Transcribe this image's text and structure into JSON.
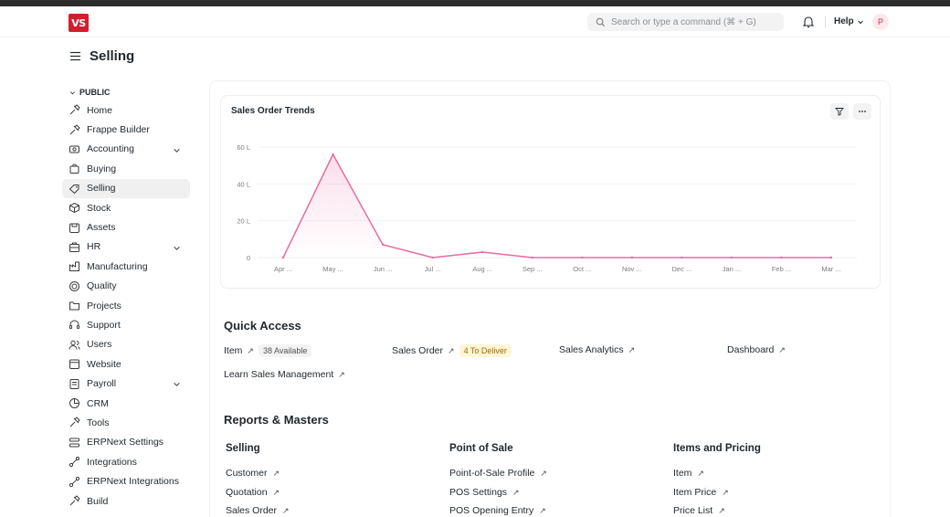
{
  "app": {
    "logo_text": "VS",
    "search_placeholder": "Search or type a command (⌘ + G)",
    "help_label": "Help",
    "avatar_initial": "P",
    "page_title": "Selling"
  },
  "sidebar": {
    "section_label": "PUBLIC",
    "items": [
      {
        "label": "Home",
        "icon": "tools-icon"
      },
      {
        "label": "Frappe Builder",
        "icon": "tools-icon"
      },
      {
        "label": "Accounting",
        "icon": "accounting-icon"
      },
      {
        "label": "Buying",
        "icon": "buying-icon"
      },
      {
        "label": "Selling",
        "icon": "selling-icon"
      },
      {
        "label": "Stock",
        "icon": "stock-icon"
      },
      {
        "label": "Assets",
        "icon": "assets-icon"
      },
      {
        "label": "HR",
        "icon": "hr-icon"
      },
      {
        "label": "Manufacturing",
        "icon": "manufacturing-icon"
      },
      {
        "label": "Quality",
        "icon": "quality-icon"
      },
      {
        "label": "Projects",
        "icon": "projects-icon"
      },
      {
        "label": "Support",
        "icon": "support-icon"
      },
      {
        "label": "Users",
        "icon": "users-icon"
      },
      {
        "label": "Website",
        "icon": "website-icon"
      },
      {
        "label": "Payroll",
        "icon": "payroll-icon"
      },
      {
        "label": "CRM",
        "icon": "crm-icon"
      },
      {
        "label": "Tools",
        "icon": "tools-icon"
      },
      {
        "label": "ERPNext Settings",
        "icon": "settings-icon"
      },
      {
        "label": "Integrations",
        "icon": "integrations-icon"
      },
      {
        "label": "ERPNext Integrations",
        "icon": "integrations-icon"
      },
      {
        "label": "Build",
        "icon": "tools-icon"
      }
    ]
  },
  "chart": {
    "title": "Sales Order Trends",
    "filter_icon": "filter-icon",
    "menu_icon": "more-icon",
    "color": "#e86ba3"
  },
  "chart_data": {
    "type": "line",
    "categories": [
      "Apr ...",
      "May ...",
      "Jun ...",
      "Jul ...",
      "Aug ...",
      "Sep ...",
      "Oct ...",
      "Nov ...",
      "Dec ...",
      "Jan ...",
      "Feb ...",
      "Mar ..."
    ],
    "values": [
      0,
      56,
      7,
      0,
      3,
      0,
      0,
      0,
      0,
      0,
      0,
      0
    ],
    "y_ticks": [
      "0",
      "20 L",
      "40 L",
      "60 L"
    ],
    "ylim": [
      0,
      60
    ],
    "ylabel_unit": "L",
    "grid": true
  },
  "quick_access": {
    "title": "Quick Access",
    "links": [
      {
        "label": "Item",
        "badge": "38 Available",
        "badge_style": "gray"
      },
      {
        "label": "Sales Order",
        "badge": "4 To Deliver",
        "badge_style": "yellow"
      },
      {
        "label": "Sales Analytics",
        "badge": ""
      },
      {
        "label": "Dashboard",
        "badge": ""
      },
      {
        "label": "Learn Sales Management",
        "badge": ""
      }
    ]
  },
  "reports": {
    "title": "Reports & Masters",
    "columns": [
      {
        "title": "Selling",
        "links": [
          "Customer",
          "Quotation",
          "Sales Order"
        ]
      },
      {
        "title": "Point of Sale",
        "links": [
          "Point-of-Sale Profile",
          "POS Settings",
          "POS Opening Entry"
        ]
      },
      {
        "title": "Items and Pricing",
        "links": [
          "Item",
          "Item Price",
          "Price List"
        ]
      }
    ]
  }
}
